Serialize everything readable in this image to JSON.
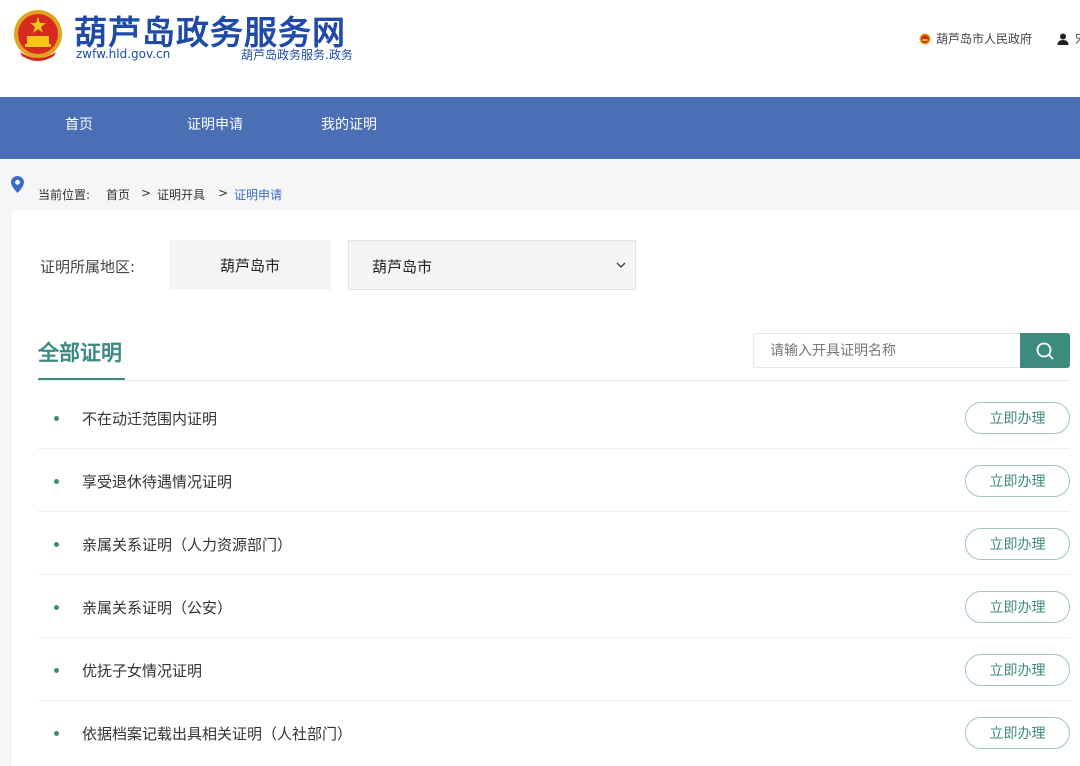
{
  "header": {
    "site_title": "葫芦岛政务服务网",
    "domain": "zwfw.hld.gov.cn",
    "slogan": "葫芦岛政务服务.政务",
    "gov_link": "葫芦岛市人民政府",
    "user_link": "宋"
  },
  "nav": {
    "items": [
      "首页",
      "证明申请",
      "我的证明"
    ]
  },
  "breadcrumb": {
    "label": "当前位置:",
    "home": "首页",
    "separator": ">",
    "middle": "证明开具",
    "current": "证明申请"
  },
  "region": {
    "label": "证明所属地区:",
    "city": "葫芦岛市",
    "select_value": "葫芦岛市"
  },
  "section": {
    "title": "全部证明"
  },
  "search": {
    "placeholder": "请输入开具证明名称"
  },
  "certificates": [
    {
      "name": "不在动迁范围内证明",
      "action": "立即办理"
    },
    {
      "name": "享受退休待遇情况证明",
      "action": "立即办理"
    },
    {
      "name": "亲属关系证明（人力资源部门）",
      "action": "立即办理"
    },
    {
      "name": "亲属关系证明（公安）",
      "action": "立即办理"
    },
    {
      "name": "优抚子女情况证明",
      "action": "立即办理"
    },
    {
      "name": "依据档案记载出具相关证明（人社部门）",
      "action": "立即办理"
    }
  ],
  "colors": {
    "brand_blue": "#1f4aa8",
    "nav_bg": "#4a6fb5",
    "accent_teal": "#3d8a7f"
  }
}
